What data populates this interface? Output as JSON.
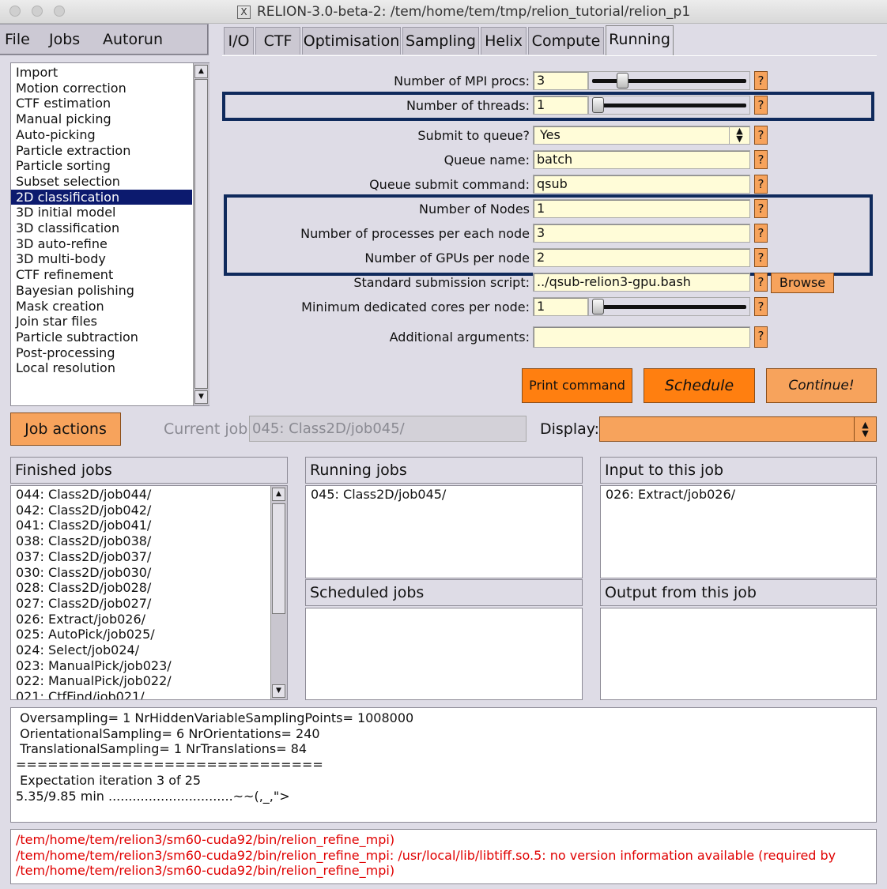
{
  "window": {
    "title": "RELION-3.0-beta-2: /tem/home/tem/tmp/relion_tutorial/relion_p1"
  },
  "menu": {
    "file": "File",
    "jobs": "Jobs",
    "autorun": "Autorun"
  },
  "tabs": [
    "I/O",
    "CTF",
    "Optimisation",
    "Sampling",
    "Helix",
    "Compute",
    "Running"
  ],
  "job_types": [
    "Import",
    "Motion correction",
    "CTF estimation",
    "Manual picking",
    "Auto-picking",
    "Particle extraction",
    "Particle sorting",
    "Subset selection",
    "2D classification",
    "3D initial model",
    "3D classification",
    "3D auto-refine",
    "3D multi-body",
    "CTF refinement",
    "Bayesian polishing",
    "Mask creation",
    "Join star files",
    "Particle subtraction",
    "Post-processing",
    "Local resolution"
  ],
  "selected_job_type": "2D classification",
  "running": {
    "mpi_label": "Number of MPI procs:",
    "mpi_value": "3",
    "mpi_level": 0.17,
    "threads_label": "Number of threads:",
    "threads_value": "1",
    "threads_level": 0.0,
    "queue_label": "Submit to queue?",
    "queue_value": "Yes",
    "queue_name_label": "Queue name:",
    "queue_name_value": "batch",
    "submit_cmd_label": "Queue submit command:",
    "submit_cmd_value": "qsub",
    "nodes_label": "Number of Nodes",
    "nodes_value": "1",
    "procs_label": "Number of processes per each node",
    "procs_value": "3",
    "gpus_label": "Number of GPUs per node",
    "gpus_value": "2",
    "script_label": "Standard submission script:",
    "script_value": "../qsub-relion3-gpu.bash",
    "browse": "Browse",
    "min_cores_label": "Minimum dedicated cores per node:",
    "min_cores_value": "1",
    "min_cores_level": 0.0,
    "args_label": "Additional arguments:",
    "args_value": "",
    "help": "?"
  },
  "actions": {
    "print": "Print command",
    "schedule": "Schedule",
    "continue": "Continue!",
    "job_actions": "Job actions"
  },
  "current_job": {
    "label": "Current job:",
    "value": "045: Class2D/job045/"
  },
  "display": {
    "label": "Display:"
  },
  "finished": {
    "title": "Finished jobs",
    "items": [
      "044: Class2D/job044/",
      "042: Class2D/job042/",
      "041: Class2D/job041/",
      "038: Class2D/job038/",
      "037: Class2D/job037/",
      "030: Class2D/job030/",
      "028: Class2D/job028/",
      "027: Class2D/job027/",
      "026: Extract/job026/",
      "025: AutoPick/job025/",
      "024: Select/job024/",
      "023: ManualPick/job023/",
      "022: ManualPick/job022/",
      "021: CtfFind/job021/"
    ]
  },
  "running_jobs": {
    "title": "Running jobs",
    "items": [
      "045: Class2D/job045/"
    ]
  },
  "scheduled_jobs": {
    "title": "Scheduled jobs"
  },
  "input_jobs": {
    "title": "Input to this job",
    "items": [
      "026: Extract/job026/"
    ]
  },
  "output_jobs": {
    "title": "Output from this job"
  },
  "stdout": [
    " Oversampling= 1 NrHiddenVariableSamplingPoints= 1008000",
    " OrientationalSampling= 6 NrOrientations= 240",
    " TranslationalSampling= 1 NrTranslations= 84",
    "=============================",
    " Expectation iteration 3 of 25",
    "5.35/9.85 min ...............................~~(,_,\">"
  ],
  "stderr": [
    "/tem/home/tem/relion3/sm60-cuda92/bin/relion_refine_mpi)",
    "/tem/home/tem/relion3/sm60-cuda92/bin/relion_refine_mpi: /usr/local/lib/libtiff.so.5: no version information available (required by",
    "/tem/home/tem/relion3/sm60-cuda92/bin/relion_refine_mpi)"
  ],
  "colors": {
    "accent_orange": "#f7a35c",
    "bright_orange": "#ff7f10",
    "field_bg": "#fffcd8",
    "selection": "#0c1a6e",
    "highlight_box": "#0f2a5c",
    "error_text": "#e00000"
  }
}
